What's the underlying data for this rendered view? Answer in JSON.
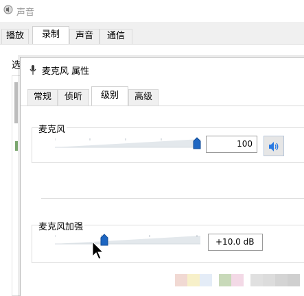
{
  "bg_window": {
    "title": "声音",
    "tabs": [
      "播放",
      "录制",
      "声音",
      "通信"
    ],
    "active_tab_index": 1,
    "panel_label_partial": "选"
  },
  "dialog": {
    "title": "麦克风 属性",
    "tabs": [
      "常规",
      "侦听",
      "级别",
      "高级"
    ],
    "active_tab_index": 2,
    "microphone": {
      "label": "麦克风",
      "value": "100",
      "level_fraction": 1.0
    },
    "boost": {
      "label": "麦克风加强",
      "value": "+10.0 dB",
      "level_fraction": 0.33
    }
  },
  "colors": {
    "thumb": "#1d66c2",
    "track_light": "#e8edf1",
    "track_dark": "#c5ccd3",
    "speaker_icon": "#2a7ae2"
  },
  "icons": {
    "title_icon": "speaker-icon",
    "dialog_icon": "microphone-icon",
    "speaker_button_icon": "speaker-volume-icon",
    "cursor": "mouse-pointer-icon"
  }
}
